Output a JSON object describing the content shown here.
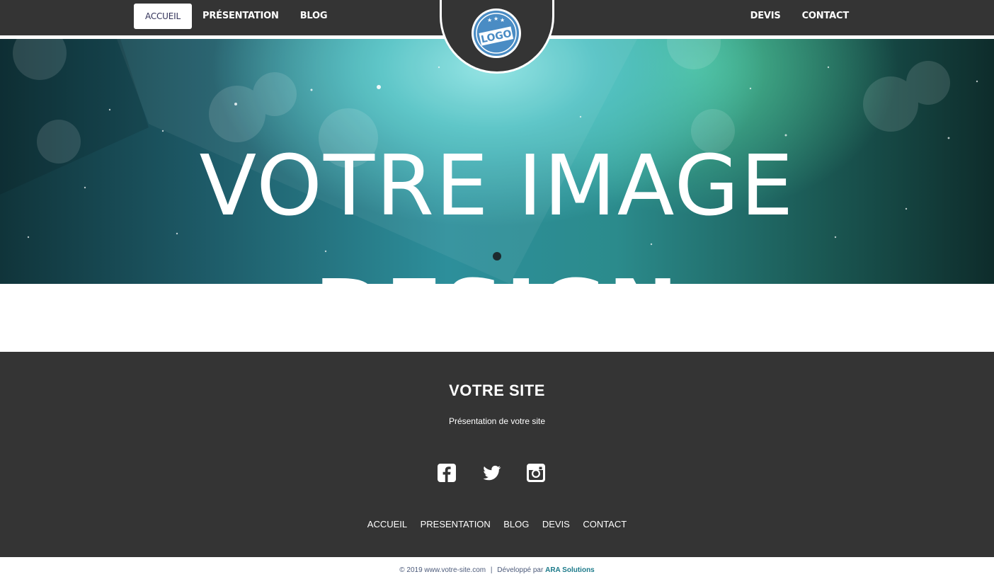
{
  "nav": {
    "left": [
      {
        "label": "ACCUEIL",
        "active": true
      },
      {
        "label": "PRÉSENTATION"
      },
      {
        "label": "BLOG"
      }
    ],
    "right": [
      {
        "label": "DEVIS"
      },
      {
        "label": "CONTACT"
      }
    ],
    "logo_text": "LOGO"
  },
  "hero": {
    "title": "VOTRE IMAGE",
    "subword": "DESIGN"
  },
  "footer": {
    "title": "VOTRE SITE",
    "description": "Présentation de votre site",
    "social": [
      "facebook-icon",
      "twitter-icon",
      "instagram-icon"
    ],
    "links": [
      "ACCUEIL",
      "PRESENTATION",
      "BLOG",
      "DEVIS",
      "CONTACT"
    ]
  },
  "copyright": {
    "text": "© 2019 www.votre-site.com",
    "separator": "|",
    "credit_prefix": "Développé par",
    "credit_name": "ARA Solutions"
  },
  "colors": {
    "bar": "#343434",
    "hero_accent": "#54c2c4",
    "credit": "#1c7a8a"
  }
}
